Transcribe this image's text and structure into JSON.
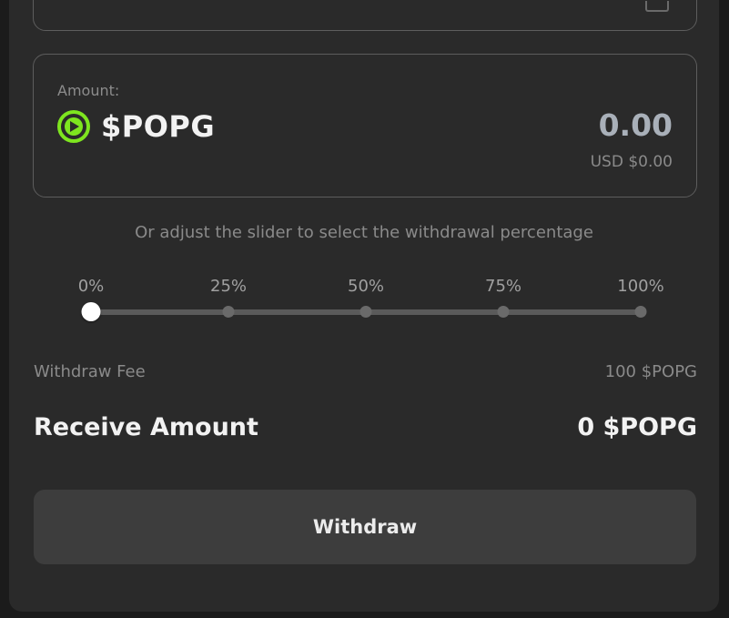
{
  "amount_card": {
    "label": "Amount:",
    "token_symbol": "$POPG",
    "token_icon": "popg-token-icon",
    "value": "0.00",
    "usd_value": "USD $0.00"
  },
  "slider": {
    "hint": "Or adjust the slider to select the withdrawal percentage",
    "ticks": [
      "0%",
      "25%",
      "50%",
      "75%",
      "100%"
    ],
    "selected_percent": 0
  },
  "fee": {
    "label": "Withdraw Fee",
    "value": "100 $POPG"
  },
  "receive": {
    "label": "Receive Amount",
    "value": "0 $POPG"
  },
  "withdraw_button": {
    "label": "Withdraw"
  },
  "colors": {
    "background": "#2a2a2a",
    "card_border": "#5d5d5d",
    "token_accent": "#7ee51f",
    "button_bg": "#3d3d3d",
    "muted_text": "#8a8a8a"
  }
}
